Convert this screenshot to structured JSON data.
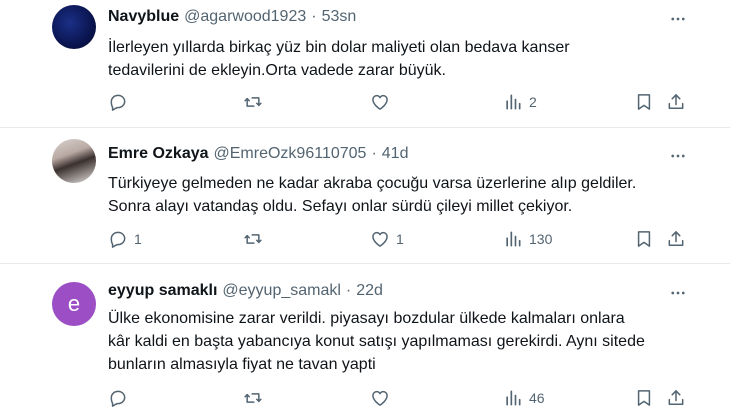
{
  "tweets": [
    {
      "avatar_letter": "",
      "name": "Navyblue",
      "handle": "@agarwood1923",
      "separator": "·",
      "time": "53sn",
      "text": [
        "İlerleyen yıllarda birkaç yüz bin dolar maliyeti olan bedava kanser",
        "tedavilerini de ekleyin.Orta vadede zarar büyük."
      ],
      "replies": "",
      "retweets": "",
      "likes": "",
      "views": "2"
    },
    {
      "avatar_letter": "",
      "name": "Emre Ozkaya",
      "handle": "@EmreOzk96110705",
      "separator": "·",
      "time": "41d",
      "text": [
        "Türkiyeye gelmeden ne kadar akraba çocuğu varsa üzerlerine alıp geldiler.",
        "Sonra alayı vatandaş oldu. Sefayı onlar sürdü çileyi millet çekiyor."
      ],
      "replies": "1",
      "retweets": "",
      "likes": "1",
      "views": "130"
    },
    {
      "avatar_letter": "e",
      "name": "eyyup samaklı",
      "handle": "@eyyup_samakl",
      "separator": "·",
      "time": "22d",
      "text": [
        "Ülke ekonomisine zarar verildi. piyasayı bozdular ülkede kalmaları onlara",
        "kâr kaldi en başta yabancıya konut satışı yapılmaması gerekirdi. Aynı sitede",
        "bunların almasıyla fiyat ne tavan  yapti"
      ],
      "replies": "",
      "retweets": "",
      "likes": "",
      "views": "46"
    }
  ],
  "icons": {
    "reply": "reply-icon",
    "retweet": "retweet-icon",
    "like": "heart-icon",
    "views": "views-icon",
    "bookmark": "bookmark-icon",
    "share": "share-icon",
    "more": "more-icon"
  },
  "colors": {
    "text": "#0f1419",
    "secondary": "#536471",
    "divider": "#e7e9ea",
    "avatar_e": "#9c4fc4"
  }
}
